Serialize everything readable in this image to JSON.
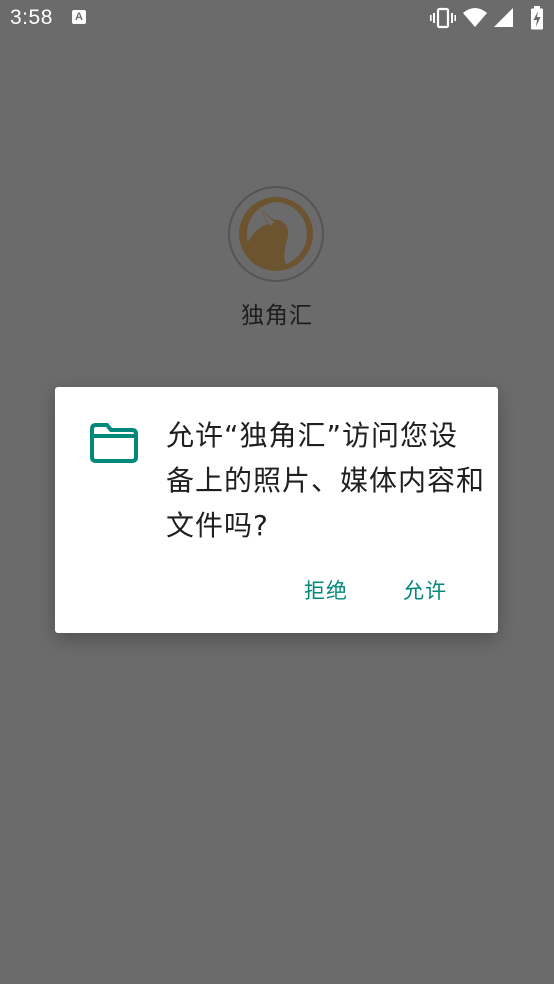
{
  "status_bar": {
    "time": "3:58",
    "notification_icon": "a-icon",
    "icons": [
      "vibrate-icon",
      "wifi-icon",
      "signal-icon",
      "battery-charging-icon"
    ]
  },
  "app": {
    "name": "独角汇",
    "logo": "unicorn-logo"
  },
  "dialog": {
    "icon": "folder-icon",
    "message": "允许“独角汇”访问您设备上的照片、媒体内容和文件吗?",
    "deny_label": "拒绝",
    "allow_label": "允许",
    "accent_color": "#00897b"
  }
}
